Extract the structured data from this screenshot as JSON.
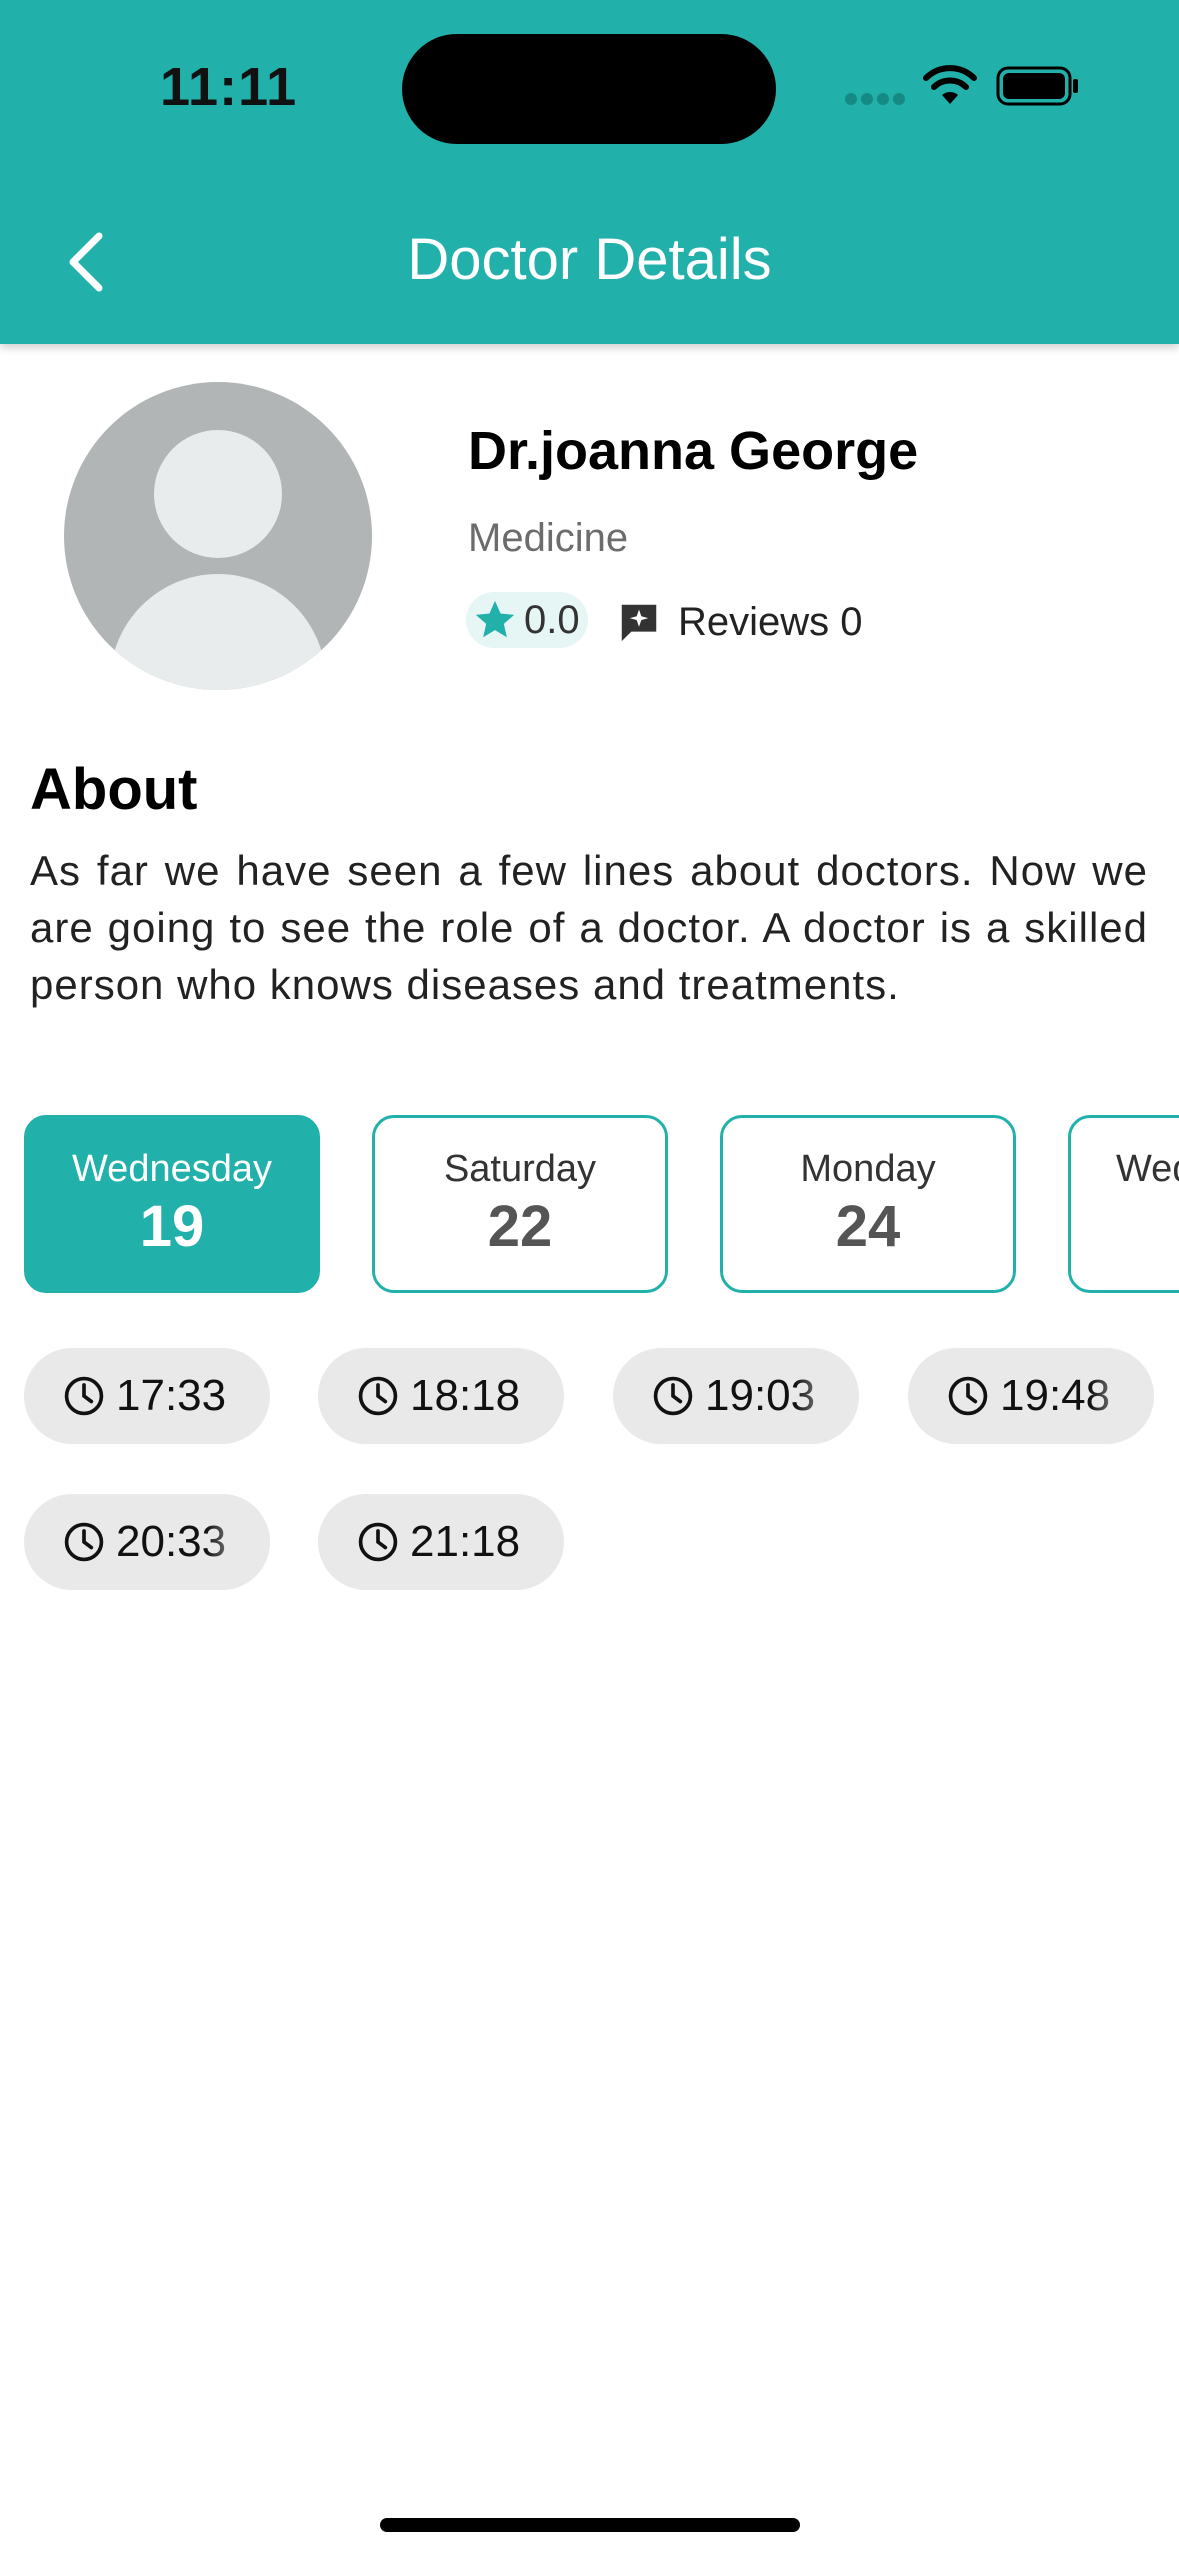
{
  "status_bar": {
    "time": "11:11"
  },
  "header": {
    "title": "Doctor Details"
  },
  "doctor": {
    "name": "Dr.joanna George",
    "specialty": "Medicine",
    "rating": "0.0",
    "reviews_label": "Reviews 0"
  },
  "about": {
    "heading": "About",
    "text": "As far we have seen a few lines about doctors. Now we are going to see the role of a doctor. A doctor is a skilled person who knows diseases and treatments."
  },
  "days": [
    {
      "name": "Wednesday",
      "date": "19",
      "selected": true
    },
    {
      "name": "Saturday",
      "date": "22",
      "selected": false
    },
    {
      "name": "Monday",
      "date": "24",
      "selected": false
    },
    {
      "name": "Wednesday",
      "date": "",
      "selected": false
    }
  ],
  "time_slots": [
    "17:33",
    "18:18",
    "19:03",
    "19:48",
    "20:33",
    "21:18"
  ],
  "colors": {
    "accent": "#22b0aa",
    "slot_bg": "#e9e9e9"
  }
}
